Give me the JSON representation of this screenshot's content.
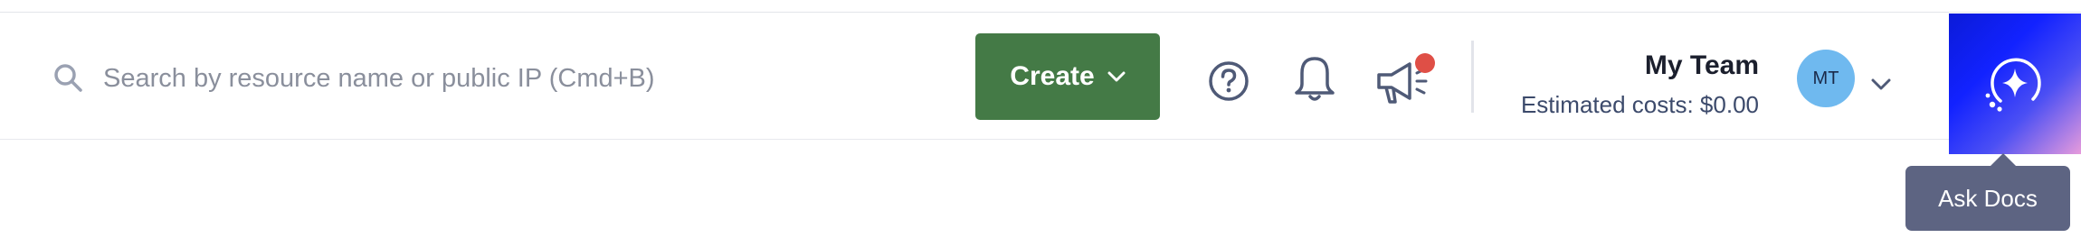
{
  "search": {
    "placeholder": "Search by resource name or public IP (Cmd+B)",
    "icon": "search-icon"
  },
  "create_button": {
    "label": "Create",
    "color": "#447a46"
  },
  "header_icons": {
    "help": "help-circle-icon",
    "notifications": "bell-icon",
    "announcements": "megaphone-icon",
    "announcement_badge_color": "#df4f46"
  },
  "team": {
    "name": "My Team",
    "costs": "Estimated costs: $0.00"
  },
  "avatar": {
    "initials": "MT",
    "color": "#6fb9ef"
  },
  "ask_docs": {
    "icon": "sparkle-icon",
    "tooltip": "Ask Docs"
  }
}
